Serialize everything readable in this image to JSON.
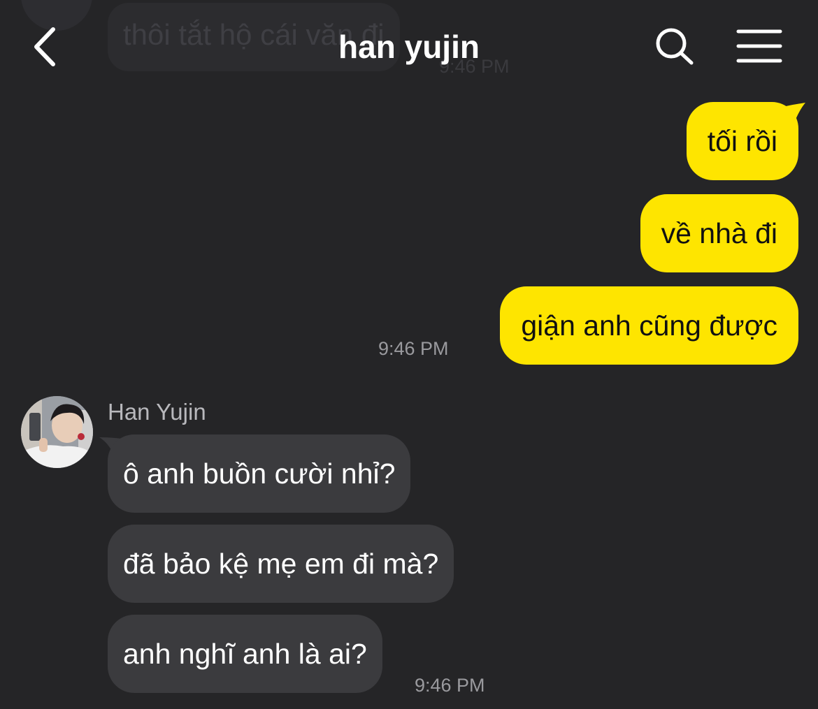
{
  "colors": {
    "background": "#252527",
    "sent_bubble": "#fee500",
    "received_bubble": "#3b3b3e",
    "timestamp": "#9a9a9e"
  },
  "header": {
    "title": "han yujin",
    "back_icon": "chevron-left-icon",
    "search_icon": "search-icon",
    "menu_icon": "hamburger-menu-icon"
  },
  "previous_message": {
    "text": "thôi tắt hộ cái văn đi",
    "time": "9:46 PM"
  },
  "sent_group": {
    "messages": [
      "tối rồi",
      "về nhà đi",
      "giận anh cũng được"
    ],
    "time": "9:46 PM"
  },
  "received_group": {
    "sender": "Han Yujin",
    "messages": [
      "ô anh buồn cười nhỉ?",
      "đã bảo kệ mẹ em đi mà?",
      "anh nghĩ anh là ai?"
    ],
    "time": "9:46 PM"
  }
}
